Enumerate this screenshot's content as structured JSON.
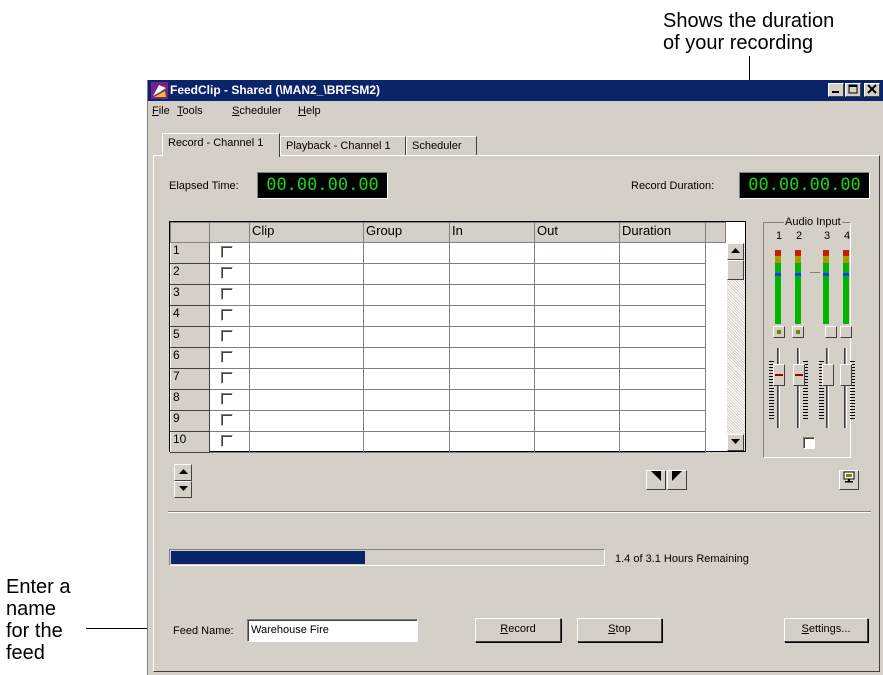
{
  "callouts": {
    "duration_line1": "Shows the duration",
    "duration_line2": "of your recording",
    "feed_name": [
      "Enter a",
      "name",
      "for the",
      "feed"
    ]
  },
  "window": {
    "title": "FeedClip -  Shared (\\MAN2_\\BRFSM2)",
    "menu": [
      {
        "key": "F",
        "rest": "ile"
      },
      {
        "key": "T",
        "rest": "ools"
      },
      {
        "key": "S",
        "rest": "cheduler"
      },
      {
        "key": "H",
        "rest": "elp"
      }
    ],
    "tabs": [
      "Record - Channel 1",
      "Playback - Channel 1",
      "Scheduler"
    ]
  },
  "record": {
    "elapsed_label": "Elapsed Time:",
    "elapsed_value": "00.00.00.00",
    "duration_label": "Record Duration:",
    "duration_value": "00.00.00.00"
  },
  "grid": {
    "columns": [
      "",
      "",
      "Clip",
      "Group",
      "In",
      "Out",
      "Duration",
      ""
    ],
    "rows": [
      "1",
      "2",
      "3",
      "4",
      "5",
      "6",
      "7",
      "8",
      "9",
      "10"
    ]
  },
  "audio": {
    "title": "Audio Input",
    "channels": [
      "1",
      "2",
      "3",
      "4"
    ]
  },
  "progress": {
    "fraction": 0.45,
    "text": "1.4 of 3.1 Hours Remaining"
  },
  "feed": {
    "label": "Feed Name:",
    "value": "Warehouse Fire"
  },
  "buttons": {
    "record_key": "R",
    "record_rest": "ecord",
    "stop_key": "S",
    "stop_rest": "top",
    "settings_key": "S",
    "settings_rest": "ettings..."
  },
  "colors": {
    "titlebar": "#0a246a",
    "lcd_text": "#1cd21c",
    "progress_fill": "#0a246a"
  }
}
